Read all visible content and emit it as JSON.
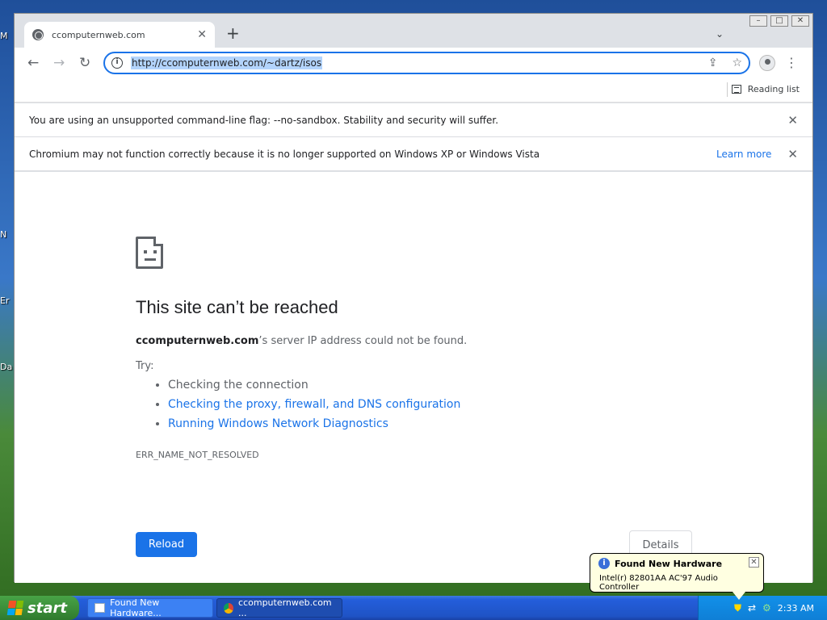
{
  "desktop": {
    "icon_fragments": [
      "M",
      "N",
      "Er",
      "Da"
    ]
  },
  "window": {
    "controls": [
      "–",
      "□",
      "✕"
    ]
  },
  "tab": {
    "title": "ccomputernweb.com",
    "icon": "globe-icon",
    "close": "✕",
    "new_tab": "+",
    "tab_search": "⌄"
  },
  "toolbar": {
    "back": "←",
    "forward": "→",
    "reload": "↻",
    "url": "http://ccomputernweb.com/~dartz/isos",
    "info": "i",
    "share": "⇪",
    "bookmark": "☆",
    "menu": "⋮"
  },
  "bookmarks": {
    "reading_list": "Reading list"
  },
  "infobars": [
    {
      "message": "You are using an unsupported command-line flag: --no-sandbox. Stability and security will suffer.",
      "link": "",
      "close": "✕"
    },
    {
      "message": "Chromium may not function correctly because it is no longer supported on Windows XP or Windows Vista",
      "link": "Learn more",
      "close": "✕"
    }
  ],
  "error_page": {
    "title": "This site can’t be reached",
    "host": "ccomputernweb.com",
    "desc_suffix": "’s server IP address could not be found.",
    "try_label": "Try:",
    "suggestions": [
      "Checking the connection",
      "Checking the proxy, firewall, and DNS configuration",
      "Running Windows Network Diagnostics"
    ],
    "error_code": "ERR_NAME_NOT_RESOLVED",
    "reload_label": "Reload",
    "details_label": "Details"
  },
  "taskbar": {
    "start_label": "start",
    "tasks": [
      "Found New Hardware...",
      "ccomputernweb.com ..."
    ],
    "clock": "2:33 AM"
  },
  "balloon": {
    "title": "Found New Hardware",
    "message": "Intel(r) 82801AA AC'97 Audio Controller",
    "close": "✕"
  },
  "colors": {
    "accent": "#1a73e8",
    "taskbar": "#245edb",
    "start": "#3c8f3a"
  }
}
